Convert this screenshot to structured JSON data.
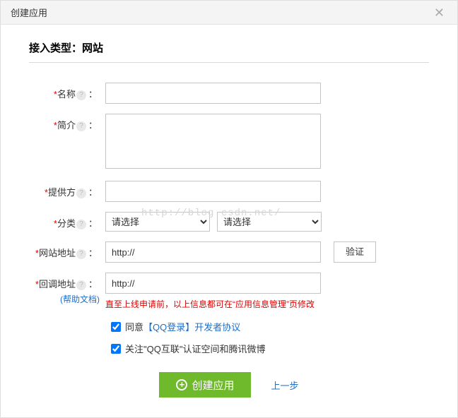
{
  "modal": {
    "title": "创建应用",
    "close": "✕"
  },
  "section_title": "接入类型：网站",
  "labels": {
    "name": "名称",
    "intro": "简介",
    "provider": "提供方",
    "category": "分类",
    "site_url": "网站地址",
    "callback_url": "回调地址",
    "colon": "："
  },
  "values": {
    "name": "",
    "intro": "",
    "provider": "",
    "site_url": "http://",
    "callback_url": "http://"
  },
  "category_placeholder": "请选择",
  "verify_btn": "验证",
  "help_doc": "(帮助文档)",
  "hint": "直至上线申请前，以上信息都可在“应用信息管理”页修改",
  "agree": {
    "prefix": "同意",
    "link": "【QQ登录】开发者协议"
  },
  "follow": "关注\"QQ互联\"认证空间和腾讯微博",
  "create_btn": "创建应用",
  "prev_step": "上一步",
  "watermark": "http://blog.csdn.net/"
}
